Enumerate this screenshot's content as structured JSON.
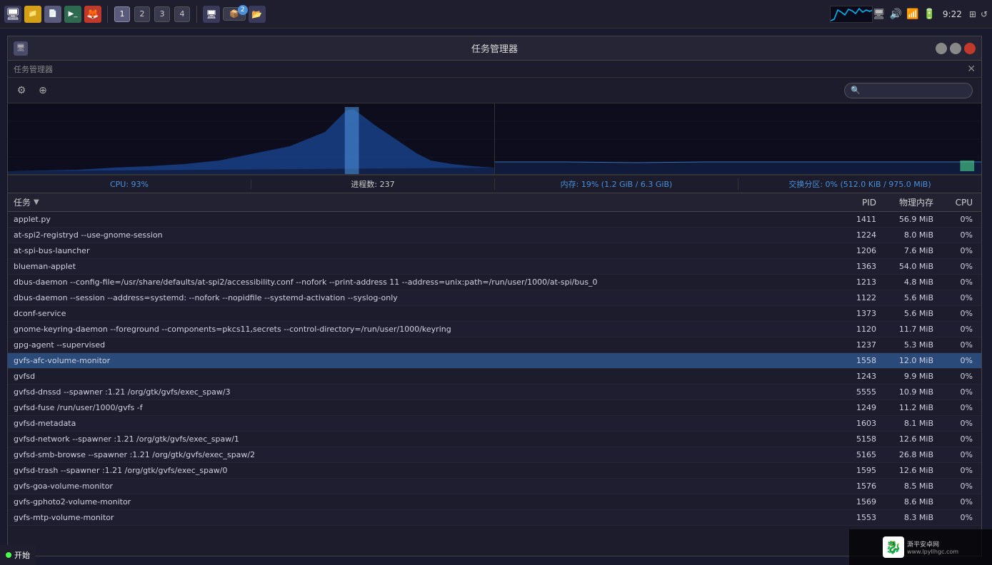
{
  "taskbar": {
    "workspaces": [
      "1",
      "2",
      "3",
      "4"
    ],
    "active_workspace": 0,
    "time": "9:22",
    "start_label": "开始",
    "tray_icons": [
      "🖥",
      "🔊",
      "📶",
      "🔋"
    ]
  },
  "window": {
    "title": "任务管理器",
    "minimize_label": "",
    "maximize_label": "",
    "close_label": ""
  },
  "statusbar": {
    "cpu_label": "CPU: 93%",
    "proc_label": "进程数: 237",
    "mem_label": "内存: 19% (1.2 GiB / 6.3 GiB)",
    "swap_label": "交换分区: 0% (512.0 KiB / 975.0 MiB)"
  },
  "table": {
    "col_task": "任务",
    "col_pid": "PID",
    "col_mem": "物理内存",
    "col_cpu": "CPU"
  },
  "processes": [
    {
      "name": "applet.py",
      "pid": "1411",
      "mem": "56.9 MiB",
      "cpu": "0%"
    },
    {
      "name": "at-spi2-registryd --use-gnome-session",
      "pid": "1224",
      "mem": "8.0 MiB",
      "cpu": "0%"
    },
    {
      "name": "at-spi-bus-launcher",
      "pid": "1206",
      "mem": "7.6 MiB",
      "cpu": "0%"
    },
    {
      "name": "blueman-applet",
      "pid": "1363",
      "mem": "54.0 MiB",
      "cpu": "0%"
    },
    {
      "name": "dbus-daemon --config-file=/usr/share/defaults/at-spi2/accessibility.conf --nofork --print-address 11 --address=unix:path=/run/user/1000/at-spi/bus_0",
      "pid": "1213",
      "mem": "4.8 MiB",
      "cpu": "0%"
    },
    {
      "name": "dbus-daemon --session --address=systemd: --nofork --nopidfile --systemd-activation --syslog-only",
      "pid": "1122",
      "mem": "5.6 MiB",
      "cpu": "0%"
    },
    {
      "name": "dconf-service",
      "pid": "1373",
      "mem": "5.6 MiB",
      "cpu": "0%"
    },
    {
      "name": "gnome-keyring-daemon --foreground --components=pkcs11,secrets --control-directory=/run/user/1000/keyring",
      "pid": "1120",
      "mem": "11.7 MiB",
      "cpu": "0%"
    },
    {
      "name": "gpg-agent --supervised",
      "pid": "1237",
      "mem": "5.3 MiB",
      "cpu": "0%"
    },
    {
      "name": "gvfs-afc-volume-monitor",
      "pid": "1558",
      "mem": "12.0 MiB",
      "cpu": "0%",
      "selected": true
    },
    {
      "name": "gvfsd",
      "pid": "1243",
      "mem": "9.9 MiB",
      "cpu": "0%"
    },
    {
      "name": "gvfsd-dnssd --spawner :1.21 /org/gtk/gvfs/exec_spaw/3",
      "pid": "5555",
      "mem": "10.9 MiB",
      "cpu": "0%"
    },
    {
      "name": "gvfsd-fuse /run/user/1000/gvfs -f",
      "pid": "1249",
      "mem": "11.2 MiB",
      "cpu": "0%"
    },
    {
      "name": "gvfsd-metadata",
      "pid": "1603",
      "mem": "8.1 MiB",
      "cpu": "0%"
    },
    {
      "name": "gvfsd-network --spawner :1.21 /org/gtk/gvfs/exec_spaw/1",
      "pid": "5158",
      "mem": "12.6 MiB",
      "cpu": "0%"
    },
    {
      "name": "gvfsd-smb-browse --spawner :1.21 /org/gtk/gvfs/exec_spaw/2",
      "pid": "5165",
      "mem": "26.8 MiB",
      "cpu": "0%"
    },
    {
      "name": "gvfsd-trash --spawner :1.21 /org/gtk/gvfs/exec_spaw/0",
      "pid": "1595",
      "mem": "12.6 MiB",
      "cpu": "0%"
    },
    {
      "name": "gvfs-goa-volume-monitor",
      "pid": "1576",
      "mem": "8.5 MiB",
      "cpu": "0%"
    },
    {
      "name": "gvfs-gphoto2-volume-monitor",
      "pid": "1569",
      "mem": "8.6 MiB",
      "cpu": "0%"
    },
    {
      "name": "gvfs-mtp-volume-monitor",
      "pid": "1553",
      "mem": "8.3 MiB",
      "cpu": "0%"
    }
  ]
}
